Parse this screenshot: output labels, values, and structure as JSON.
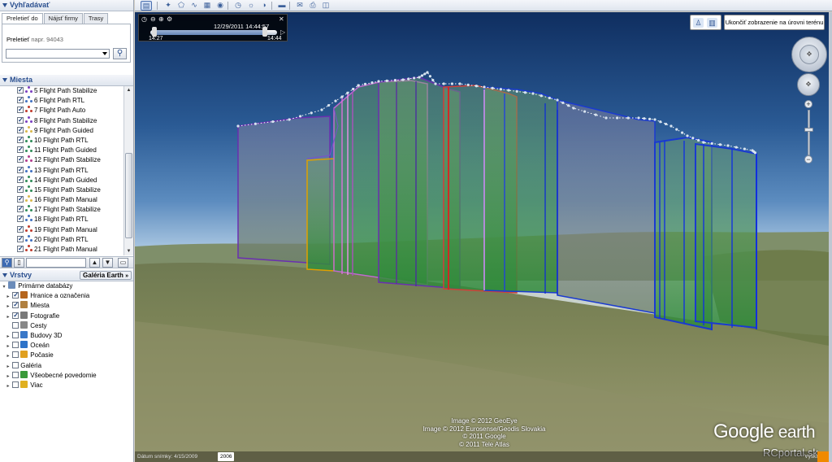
{
  "search": {
    "title": "Vyhľadávať",
    "tabs": [
      "Preletieť do",
      "Nájsť firmy",
      "Trasy"
    ],
    "fly_label": "Preletieť",
    "fly_hint": "napr. 94043",
    "input_value": ""
  },
  "places": {
    "title": "Miesta",
    "items": [
      {
        "label": "5 Flight Path Stabilize",
        "color": "#7a3fc0"
      },
      {
        "label": "6 Flight Path RTL",
        "color": "#3f6fc0"
      },
      {
        "label": "7 Flight Path Auto",
        "color": "#c0392b"
      },
      {
        "label": "8 Flight Path Stabilize",
        "color": "#7a3fc0"
      },
      {
        "label": "9 Flight Path Guided",
        "color": "#d8b84a"
      },
      {
        "label": "10 Flight Path RTL",
        "color": "#2e8b57"
      },
      {
        "label": "11 Flight Path Guided",
        "color": "#2e8b57"
      },
      {
        "label": "12 Flight Path Stabilize",
        "color": "#b03a8c"
      },
      {
        "label": "13 Flight Path RTL",
        "color": "#3f6fc0"
      },
      {
        "label": "14 Flight Path Guided",
        "color": "#2e8b57"
      },
      {
        "label": "15 Flight Path Stabilize",
        "color": "#2e8b57"
      },
      {
        "label": "16 Flight Path Manual",
        "color": "#d8b84a"
      },
      {
        "label": "17 Flight Path Stabilize",
        "color": "#2e8b57"
      },
      {
        "label": "18 Flight Path RTL",
        "color": "#3f6fc0"
      },
      {
        "label": "19 Flight Path Manual",
        "color": "#c0392b"
      },
      {
        "label": "20 Flight Path RTL",
        "color": "#3f6fc0"
      },
      {
        "label": "21 Flight Path Manual",
        "color": "#c0392b"
      }
    ]
  },
  "layers": {
    "title": "Vrstvy",
    "gallery_button": "Galéria Earth",
    "items": [
      {
        "label": "Primárne databázy",
        "indent": 0,
        "expander": "▾",
        "checkbox": false,
        "icon_color": "#6b8cba"
      },
      {
        "label": "Hranice a označenia",
        "indent": 1,
        "expander": "▸",
        "checkbox": true,
        "icon_color": "#b5651d"
      },
      {
        "label": "Miesta",
        "indent": 1,
        "expander": "▸",
        "checkbox": true,
        "icon_color": "#b08040"
      },
      {
        "label": "Fotografie",
        "indent": 1,
        "expander": "▸",
        "checkbox": true,
        "icon_color": "#7a7a7a"
      },
      {
        "label": "Cesty",
        "indent": 1,
        "expander": "",
        "checkbox": false,
        "icon_color": "#888888"
      },
      {
        "label": "Budovy 3D",
        "indent": 1,
        "expander": "▸",
        "checkbox": false,
        "icon_color": "#3a78c8"
      },
      {
        "label": "Oceán",
        "indent": 1,
        "expander": "▸",
        "checkbox": false,
        "icon_color": "#2d73c9"
      },
      {
        "label": "Počasie",
        "indent": 1,
        "expander": "▸",
        "checkbox": false,
        "icon_color": "#e0a020"
      },
      {
        "label": "Galéria",
        "indent": 1,
        "expander": "▸",
        "checkbox": false,
        "icon_color": ""
      },
      {
        "label": "Všeobecné povedomie",
        "indent": 1,
        "expander": "▸",
        "checkbox": false,
        "icon_color": "#3a9a3a"
      },
      {
        "label": "Viac",
        "indent": 1,
        "expander": "▸",
        "checkbox": false,
        "icon_color": "#e0b020"
      }
    ]
  },
  "time_slider": {
    "current": "12/29/2011  14:44:57",
    "start": "14:27",
    "end": "14:44"
  },
  "view": {
    "exit_ground_label": "Ukončiť zobrazenie na úrovni terénu",
    "credits": [
      "Image © 2012 GeoEye",
      "Image © 2012 Eurosense/Geodis Slovakia",
      "© 2011 Google",
      "© 2011 Tele Atlas"
    ],
    "logo_google": "Google",
    "logo_earth": " earth",
    "watermark": "RCportal.sk",
    "status_date": "Dátum snímky: 4/15/2009",
    "status_year": "2006",
    "status_right": "Výška"
  }
}
